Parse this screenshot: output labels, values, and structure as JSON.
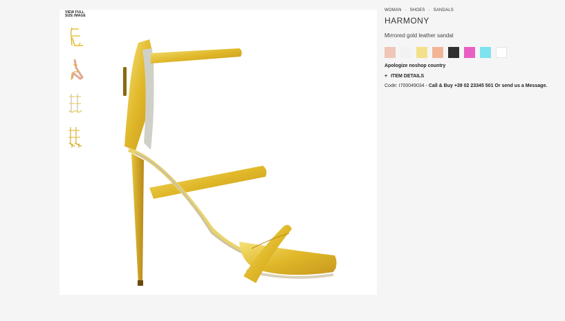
{
  "gallery": {
    "view_full_size": "VIEW FULL SIZE IMAGE",
    "thumbnails": [
      "thumbnail-side",
      "thumbnail-worn",
      "thumbnail-pair-front",
      "thumbnail-pair-back"
    ]
  },
  "breadcrumb": {
    "items": [
      "WOMAN",
      "SHOES",
      "SANDALS"
    ],
    "separator": "-"
  },
  "product": {
    "name": "HARMONY",
    "description": "Mirrored gold leather sandal",
    "swatches": [
      "#efc6b7",
      "#f2f2f2",
      "#f3e08a",
      "#f2b697",
      "#2f2f2f",
      "#e85fc4",
      "#7ee3ee",
      "#ffffff"
    ],
    "country_notice": "Apologize noshop country",
    "details_toggle": "+",
    "details_label": "ITEM DETAILS",
    "code_label": "Code:",
    "code_value": "I700049034",
    "code_dash": "-",
    "contact": "Call & Buy +39 02 23345 501 Or send us a Message."
  }
}
